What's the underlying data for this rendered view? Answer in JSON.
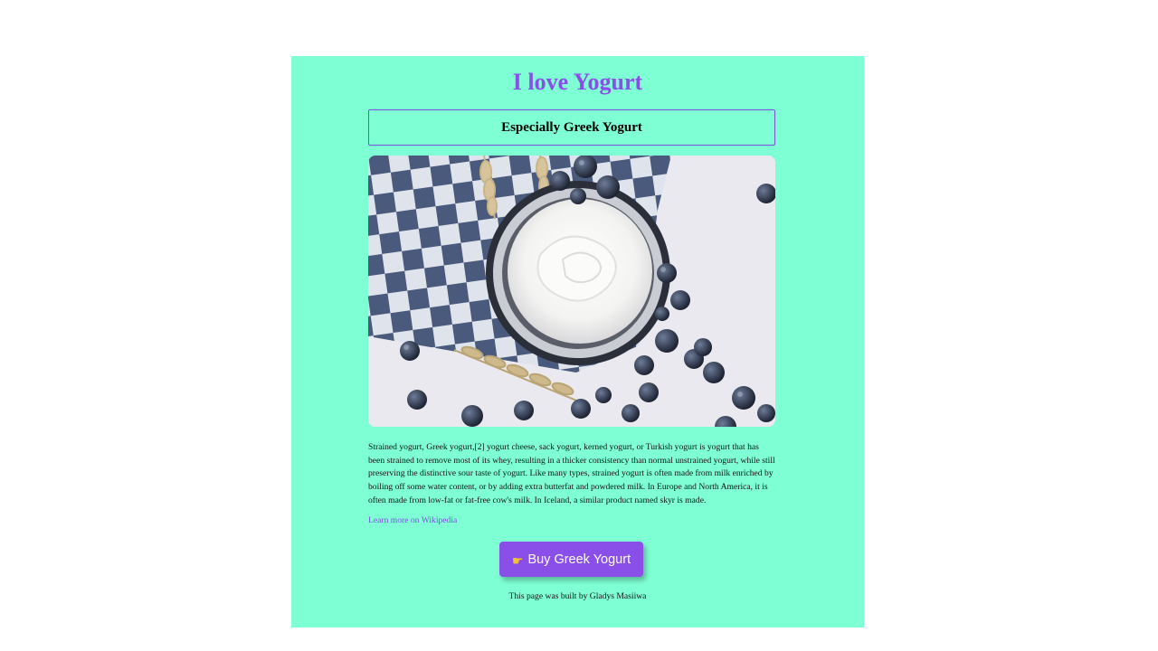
{
  "page": {
    "title": "I love Yogurt",
    "subtitle": "Especially Greek Yogurt",
    "image_alt": "Bowl of Greek yogurt with blueberries and wheat on a checkered cloth",
    "description": "Strained yogurt, Greek yogurt,[2] yogurt cheese, sack yogurt, kerned yogurt, or Turkish yogurt is yogurt that has been strained to remove most of its whey, resulting in a thicker consistency than normal unstrained yogurt, while still preserving the distinctive sour taste of yogurt. Like many types, strained yogurt is often made from milk enriched by boiling off some water content, or by adding extra butterfat and powdered milk. In Europe and North America, it is often made from low-fat or fat-free cow's milk. In Iceland, a similar product named skyr is made.",
    "link_text": "Learn more on Wikipedia",
    "button_label": "Buy Greek Yogurt",
    "button_icon": "pointing-hand-icon",
    "footer": "This page was built by Gladys Masiiwa"
  },
  "colors": {
    "card_background": "#7fffd4",
    "accent": "#8a4fe8",
    "border": "#7b4fe0"
  }
}
